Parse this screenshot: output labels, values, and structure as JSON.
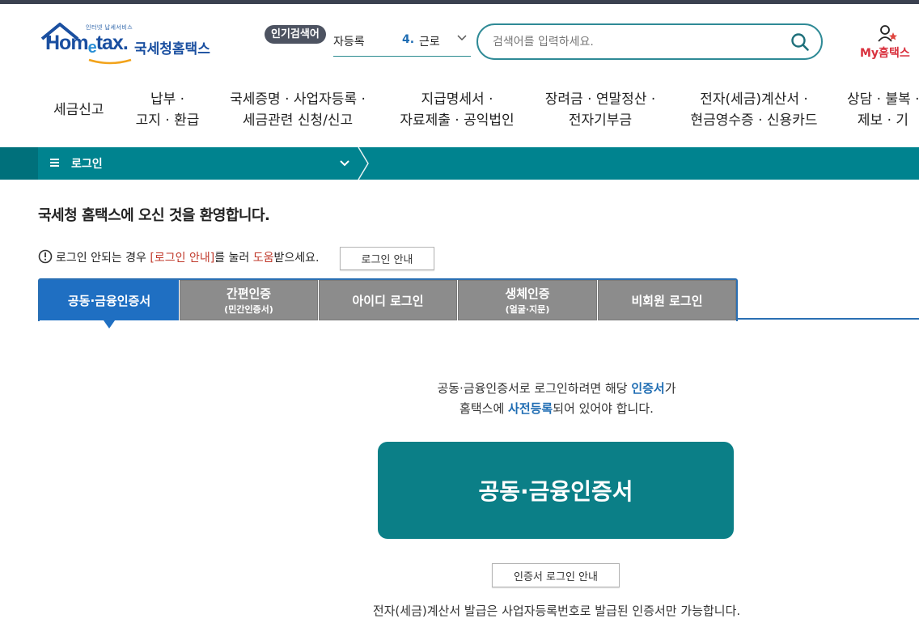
{
  "header": {
    "logo_sub": "인터넷 납세서비스",
    "logo_home": "Hom",
    "logo_e": "e",
    "logo_tax": "tax.",
    "logo_kr": "국세청홈택스",
    "popular_label": "인기검색어",
    "popular_prev": "자등록",
    "popular_num": "4.",
    "popular_current": "근로",
    "search_placeholder": "검색어를 입력하세요.",
    "mytax_label": "My홈택스"
  },
  "gnb": [
    {
      "line1": "세금신고",
      "line2": ""
    },
    {
      "line1": "납부 ·",
      "line2": "고지 · 환급"
    },
    {
      "line1": "국세증명 · 사업자등록 ·",
      "line2": "세금관련 신청/신고"
    },
    {
      "line1": "지급명세서 ·",
      "line2": "자료제출 · 공익법인"
    },
    {
      "line1": "장려금 · 연말정산 ·",
      "line2": "전자기부금"
    },
    {
      "line1": "전자(세금)계산서 ·",
      "line2": "현금영수증 · 신용카드"
    },
    {
      "line1": "상담 · 불복 ·",
      "line2": "제보 · 기"
    }
  ],
  "location_bar": {
    "menu_label": "로그인"
  },
  "main": {
    "welcome": "국세청 홈택스에 오신 것을 환영합니다.",
    "notice_pre": "로그인 안되는 경우 ",
    "notice_link": "[로그인 안내]",
    "notice_mid": "를 눌러 ",
    "notice_help": "도움",
    "notice_post": "받으세요.",
    "notice_button": "로그인 안내",
    "tabs": [
      {
        "label": "공동·금융인증서",
        "sub": ""
      },
      {
        "label": "간편인증",
        "sub": "(민간인증서)"
      },
      {
        "label": "아이디 로그인",
        "sub": ""
      },
      {
        "label": "생체인증",
        "sub": "(얼굴·지문)"
      },
      {
        "label": "비회원 로그인",
        "sub": ""
      }
    ],
    "desc_line1_pre": "공동·금융인증서로 로그인하려면 해당 ",
    "desc_line1_hl": "인증서",
    "desc_line1_post": "가",
    "desc_line2_pre": "홈택스에 ",
    "desc_line2_hl": "사전등록",
    "desc_line2_post": "되어 있어야 합니다.",
    "cert_button": "공동·금융인증서",
    "cert_guide_button": "인증서 로그인 안내",
    "footnote": "전자(세금)계산서 발급은 사업자등록번호로 발급된 인증서만 가능합니다."
  },
  "colors": {
    "teal": "#00838f",
    "blue": "#1f6fc2",
    "tab_gray": "#8c8c8c",
    "mytax_red": "#d9323f"
  }
}
